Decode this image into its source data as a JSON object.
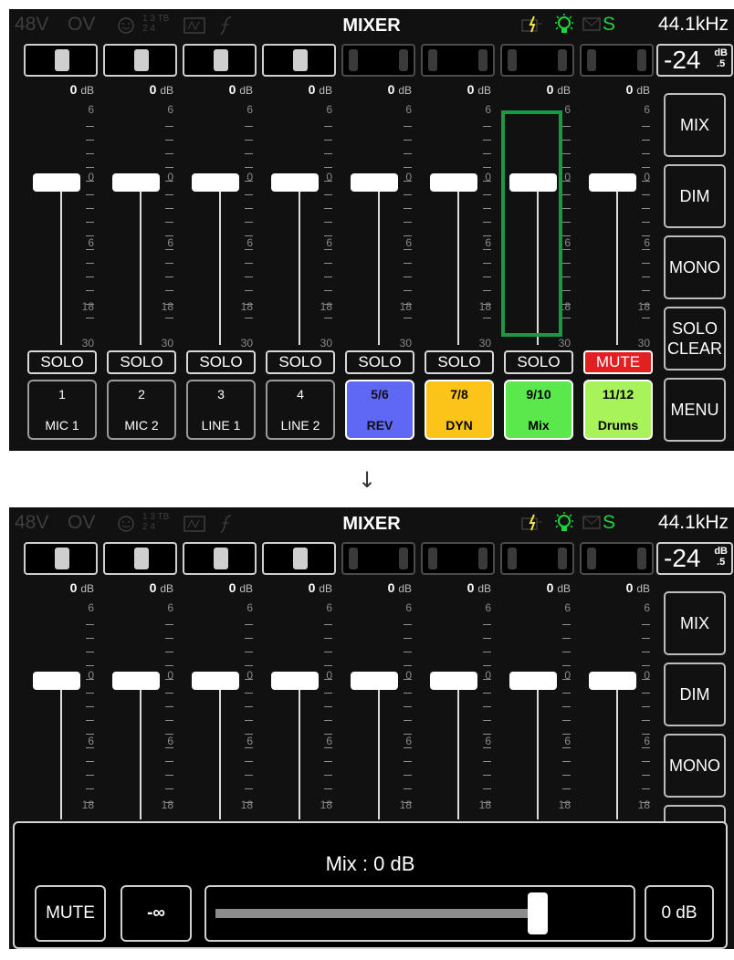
{
  "status_bar": {
    "phantom": "48V",
    "ov": "OV",
    "input_nums": "1 3 TB\n2 4",
    "title": "MIXER",
    "solo_indicator": "S",
    "sample_rate": "44.1kHz",
    "icons": [
      "face-icon",
      "input-icon",
      "usb-icon",
      "script-f-icon",
      "power-icon",
      "lightbulb-icon",
      "mail-icon"
    ],
    "colors": {
      "green": "#1fd63a",
      "lightning": "#f2e640",
      "dim": "#3e3e3e"
    }
  },
  "master_level": {
    "value": "-24",
    "unit_top": "dB",
    "unit_bottom": ".5"
  },
  "scale_labels": [
    "6",
    "0",
    "6",
    "18",
    "30"
  ],
  "channels": [
    {
      "number": "1",
      "name": "MIC 1",
      "gain": "0",
      "unit": "dB",
      "button": "SOLO",
      "color": null,
      "meter": "on"
    },
    {
      "number": "2",
      "name": "MIC 2",
      "gain": "0",
      "unit": "dB",
      "button": "SOLO",
      "color": null,
      "meter": "on"
    },
    {
      "number": "3",
      "name": "LINE 1",
      "gain": "0",
      "unit": "dB",
      "button": "SOLO",
      "color": null,
      "meter": "on"
    },
    {
      "number": "4",
      "name": "LINE 2",
      "gain": "0",
      "unit": "dB",
      "button": "SOLO",
      "color": null,
      "meter": "on"
    },
    {
      "number": "5/6",
      "name": "REV",
      "gain": "0",
      "unit": "dB",
      "button": "SOLO",
      "color": "#5f68f4",
      "meter": "off"
    },
    {
      "number": "7/8",
      "name": "DYN",
      "gain": "0",
      "unit": "dB",
      "button": "SOLO",
      "color": "#fcc418",
      "meter": "off"
    },
    {
      "number": "9/10",
      "name": "Mix",
      "gain": "0",
      "unit": "dB",
      "button": "SOLO",
      "color": "#5be84d",
      "meter": "off"
    },
    {
      "number": "11/12",
      "name": "Drums",
      "gain": "0",
      "unit": "dB",
      "button": "MUTE",
      "color": "#a8f25a",
      "meter": "off"
    }
  ],
  "side_buttons": [
    "MIX",
    "DIM",
    "MONO",
    "SOLO\nCLEAR",
    "MENU"
  ],
  "popup": {
    "title": "Mix : 0 dB",
    "mute_label": "MUTE",
    "neg_inf_label": "-∞",
    "zero_label": "0 dB",
    "slider_level_fraction": 0.77
  }
}
